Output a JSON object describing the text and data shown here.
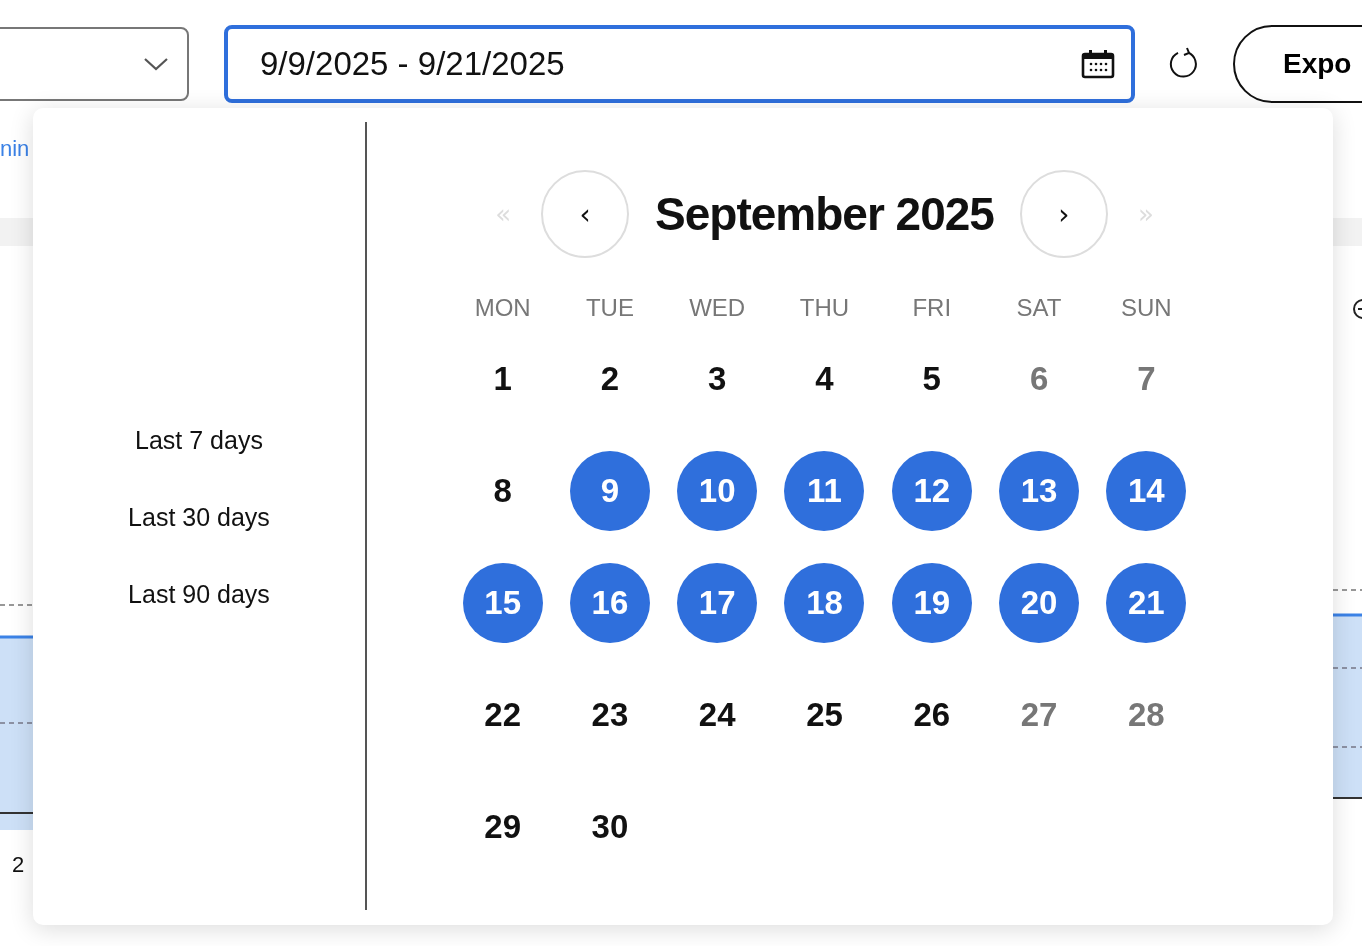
{
  "toolbar": {
    "date_range": {
      "value": "9/9/2025 - 9/21/2025",
      "focused": true
    },
    "export_button": {
      "label": "Expo"
    }
  },
  "background": {
    "link": "nin",
    "axis_label": "2"
  },
  "date_picker": {
    "presets": [
      {
        "label": "Last 7 days",
        "selected": false
      },
      {
        "label": "Last 30 days",
        "selected": false
      },
      {
        "label": "Last 90 days",
        "selected": false
      }
    ],
    "prev_year": {
      "label": "«",
      "disabled": true
    },
    "prev_month": {
      "label": "‹",
      "disabled": false
    },
    "month_title": "September 2025",
    "next_month": {
      "label": "›",
      "disabled": false
    },
    "next_year": {
      "label": "»",
      "disabled": true
    },
    "weekdays": [
      "MON",
      "TUE",
      "WED",
      "THU",
      "FRI",
      "SAT",
      "SUN"
    ],
    "days": [
      {
        "label": "1",
        "selected": false,
        "dimmed": false
      },
      {
        "label": "2",
        "selected": false,
        "dimmed": false
      },
      {
        "label": "3",
        "selected": false,
        "dimmed": false
      },
      {
        "label": "4",
        "selected": false,
        "dimmed": false
      },
      {
        "label": "5",
        "selected": false,
        "dimmed": false
      },
      {
        "label": "6",
        "selected": false,
        "dimmed": true
      },
      {
        "label": "7",
        "selected": false,
        "dimmed": true
      },
      {
        "label": "8",
        "selected": false,
        "dimmed": false
      },
      {
        "label": "9",
        "selected": true,
        "dimmed": false
      },
      {
        "label": "10",
        "selected": true,
        "dimmed": false
      },
      {
        "label": "11",
        "selected": true,
        "dimmed": false
      },
      {
        "label": "12",
        "selected": true,
        "dimmed": false
      },
      {
        "label": "13",
        "selected": true,
        "dimmed": false
      },
      {
        "label": "14",
        "selected": true,
        "dimmed": false
      },
      {
        "label": "15",
        "selected": true,
        "dimmed": false
      },
      {
        "label": "16",
        "selected": true,
        "dimmed": false
      },
      {
        "label": "17",
        "selected": true,
        "dimmed": false
      },
      {
        "label": "18",
        "selected": true,
        "dimmed": false
      },
      {
        "label": "19",
        "selected": true,
        "dimmed": false
      },
      {
        "label": "20",
        "selected": true,
        "dimmed": false
      },
      {
        "label": "21",
        "selected": true,
        "dimmed": false
      },
      {
        "label": "22",
        "selected": false,
        "dimmed": false
      },
      {
        "label": "23",
        "selected": false,
        "dimmed": false
      },
      {
        "label": "24",
        "selected": false,
        "dimmed": false
      },
      {
        "label": "25",
        "selected": false,
        "dimmed": false
      },
      {
        "label": "26",
        "selected": false,
        "dimmed": false
      },
      {
        "label": "27",
        "selected": false,
        "dimmed": true
      },
      {
        "label": "28",
        "selected": false,
        "dimmed": true
      },
      {
        "label": "29",
        "selected": false,
        "dimmed": false
      },
      {
        "label": "30",
        "selected": false,
        "dimmed": false
      }
    ]
  }
}
